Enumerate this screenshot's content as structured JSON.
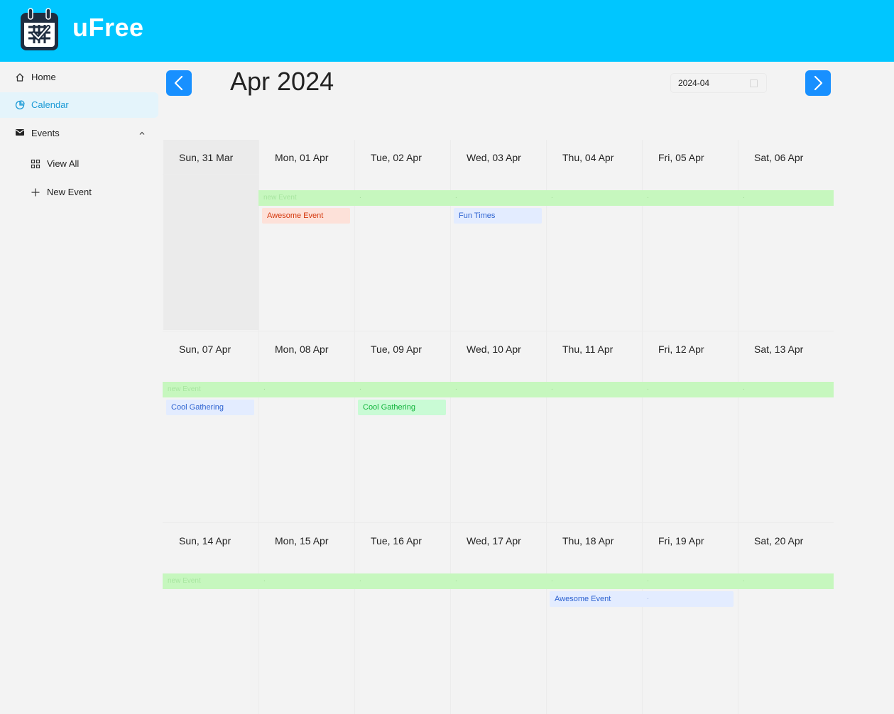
{
  "app": {
    "title": "uFree",
    "logo_icon": "calendar-check-icon"
  },
  "colors": {
    "header": "#00c6ff",
    "accent": "#1890ff",
    "allday": "#c6f7be",
    "active_nav_bg": "#e4f4fb"
  },
  "sidebar": {
    "items": [
      {
        "label": "Home",
        "icon": "home-icon"
      },
      {
        "label": "Calendar",
        "icon": "pie-chart-icon",
        "active": true
      },
      {
        "label": "Events",
        "icon": "mail-icon",
        "expanded": true
      }
    ],
    "sub_items": [
      {
        "label": "View All",
        "icon": "grid-icon"
      },
      {
        "label": "New Event",
        "icon": "plus-icon"
      }
    ]
  },
  "calendar": {
    "month_title": "Apr 2024",
    "month_value": "2024-04",
    "weeks": [
      {
        "days": [
          "Sun, 31 Mar",
          "Mon, 01 Apr",
          "Tue, 02 Apr",
          "Wed, 03 Apr",
          "Thu, 04 Apr",
          "Fri, 05 Apr",
          "Sat, 06 Apr"
        ],
        "allday_label": "new Event",
        "events": [
          {
            "label": "Awesome Event",
            "color": "red"
          },
          {
            "label": "Fun Times",
            "color": "blue"
          }
        ]
      },
      {
        "days": [
          "Sun, 07 Apr",
          "Mon, 08 Apr",
          "Tue, 09 Apr",
          "Wed, 10 Apr",
          "Thu, 11 Apr",
          "Fri, 12 Apr",
          "Sat, 13 Apr"
        ],
        "allday_label": "new Event",
        "events": [
          {
            "label": "Cool Gathering",
            "color": "blue"
          },
          {
            "label": "Cool Gathering",
            "color": "green"
          }
        ]
      },
      {
        "days": [
          "Sun, 14 Apr",
          "Mon, 15 Apr",
          "Tue, 16 Apr",
          "Wed, 17 Apr",
          "Thu, 18 Apr",
          "Fri, 19 Apr",
          "Sat, 20 Apr"
        ],
        "allday_label": "new Event",
        "events": [
          {
            "label": "Awesome Event",
            "color": "blue"
          }
        ]
      }
    ]
  }
}
